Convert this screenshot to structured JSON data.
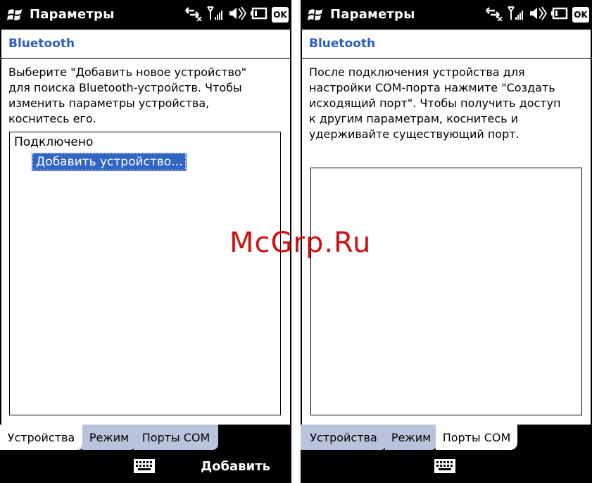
{
  "left": {
    "title": "Параметры",
    "ok": "OK",
    "section": "Bluetooth",
    "description": [
      "Выберите \"Добавить новое устройство\"",
      "для поиска Bluetooth-устройств. Чтобы",
      "изменить параметры устройства,",
      "коснитесь его."
    ],
    "list_group": "Подключено",
    "list_item": "Добавить устройство...",
    "tabs": [
      "Устройства",
      "Режим",
      "Порты COM"
    ],
    "active_tab": "Устройства",
    "softkey_right": "Добавить"
  },
  "right": {
    "title": "Параметры",
    "ok": "OK",
    "section": "Bluetooth",
    "description": [
      "После подключения устройства для",
      "настройки COM-порта нажмите \"Создать",
      "исходящий порт\". Чтобы получить доступ",
      "к другим параметрам, коснитесь и",
      "удерживайте существующий порт."
    ],
    "tabs": [
      "Устройства",
      "Режим",
      "Порты COM"
    ],
    "active_tab": "Порты COM"
  },
  "watermark": "McGrp.Ru",
  "icons": [
    "windows-flag-icon",
    "sync-icon",
    "signal-icon",
    "speaker-muted-icon",
    "battery-icon",
    "keyboard-icon"
  ],
  "colors": {
    "accent": "#2c5fba",
    "selection": "#3165c4",
    "tab_inactive": "#b9c4dc",
    "watermark": "#d01010"
  }
}
